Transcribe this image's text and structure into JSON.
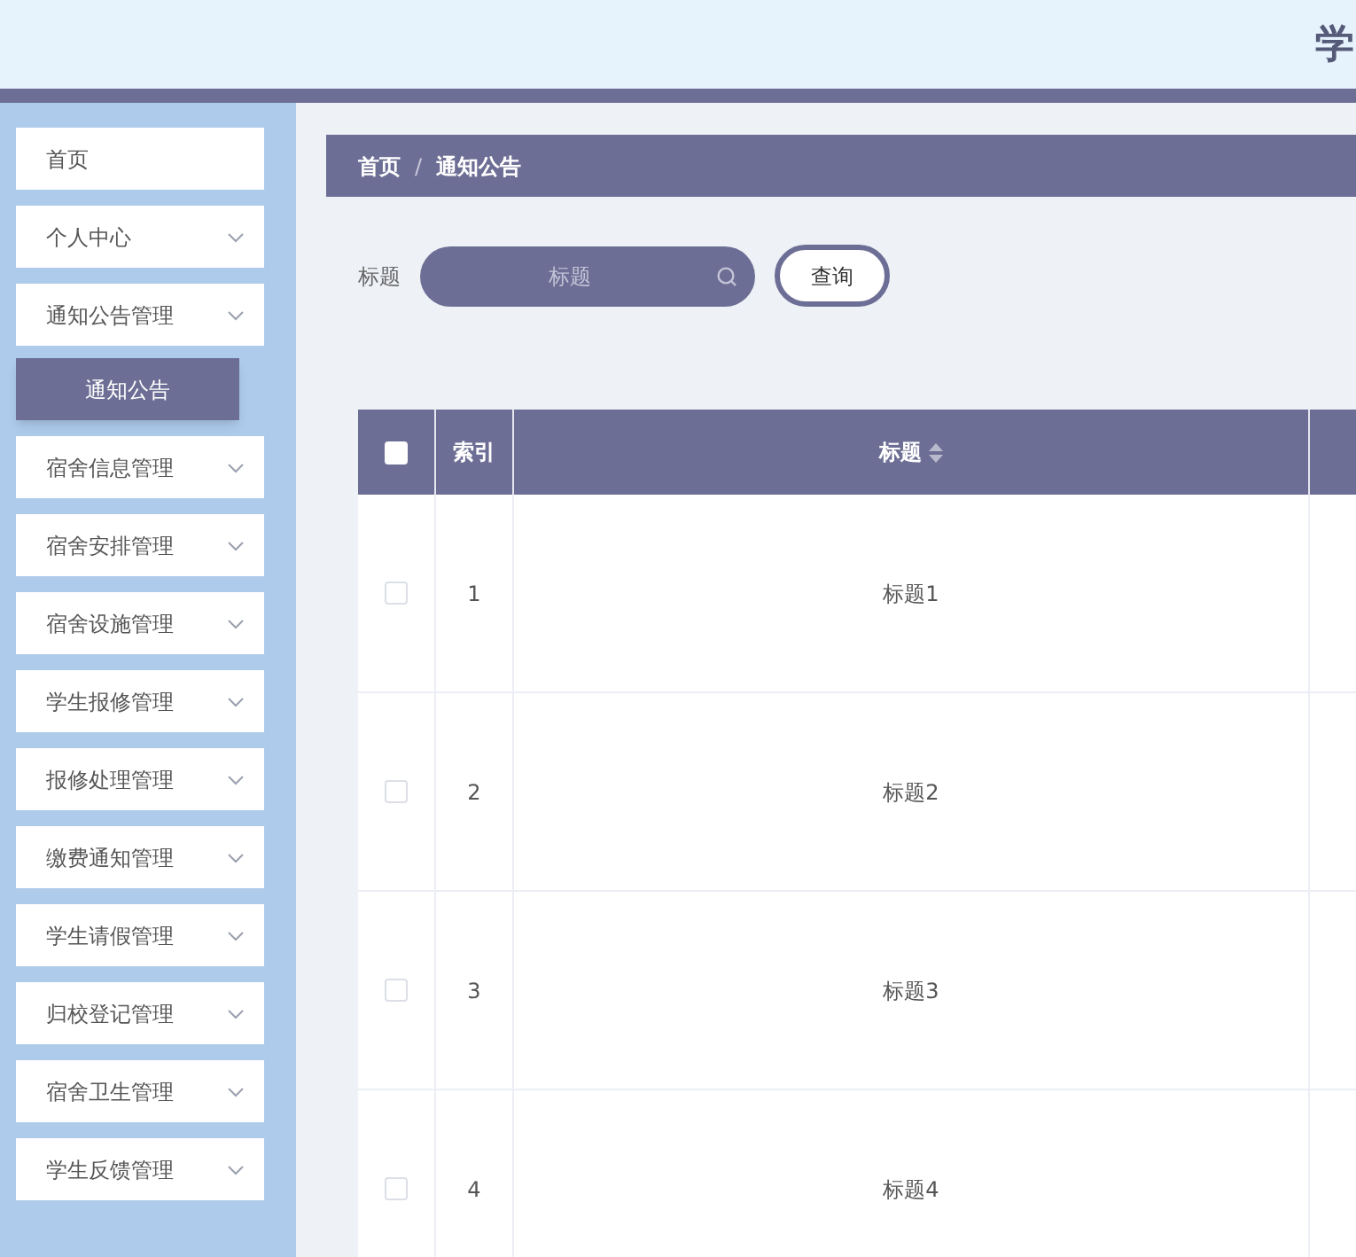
{
  "header": {
    "title": "学"
  },
  "sidebar": {
    "items": [
      {
        "label": "首页",
        "kind": "link"
      },
      {
        "label": "个人中心",
        "kind": "submenu"
      },
      {
        "label": "通知公告管理",
        "kind": "submenu",
        "children": [
          {
            "label": "通知公告",
            "selected": true
          }
        ]
      },
      {
        "label": "宿舍信息管理",
        "kind": "submenu"
      },
      {
        "label": "宿舍安排管理",
        "kind": "submenu"
      },
      {
        "label": "宿舍设施管理",
        "kind": "submenu"
      },
      {
        "label": "学生报修管理",
        "kind": "submenu"
      },
      {
        "label": "报修处理管理",
        "kind": "submenu"
      },
      {
        "label": "缴费通知管理",
        "kind": "submenu"
      },
      {
        "label": "学生请假管理",
        "kind": "submenu"
      },
      {
        "label": "归校登记管理",
        "kind": "submenu"
      },
      {
        "label": "宿舍卫生管理",
        "kind": "submenu"
      },
      {
        "label": "学生反馈管理",
        "kind": "submenu"
      }
    ]
  },
  "breadcrumb": [
    "首页",
    "/",
    "通知公告"
  ],
  "search": {
    "label": "标题",
    "placeholder": "标题",
    "button": "查询"
  },
  "table": {
    "select_all_checked": false,
    "columns": [
      "索引",
      "标题"
    ],
    "rows": [
      {
        "checked": false,
        "index": "1",
        "title": "标题1"
      },
      {
        "checked": false,
        "index": "2",
        "title": "标题2"
      },
      {
        "checked": false,
        "index": "3",
        "title": "标题3"
      },
      {
        "checked": false,
        "index": "4",
        "title": "标题4"
      }
    ]
  }
}
